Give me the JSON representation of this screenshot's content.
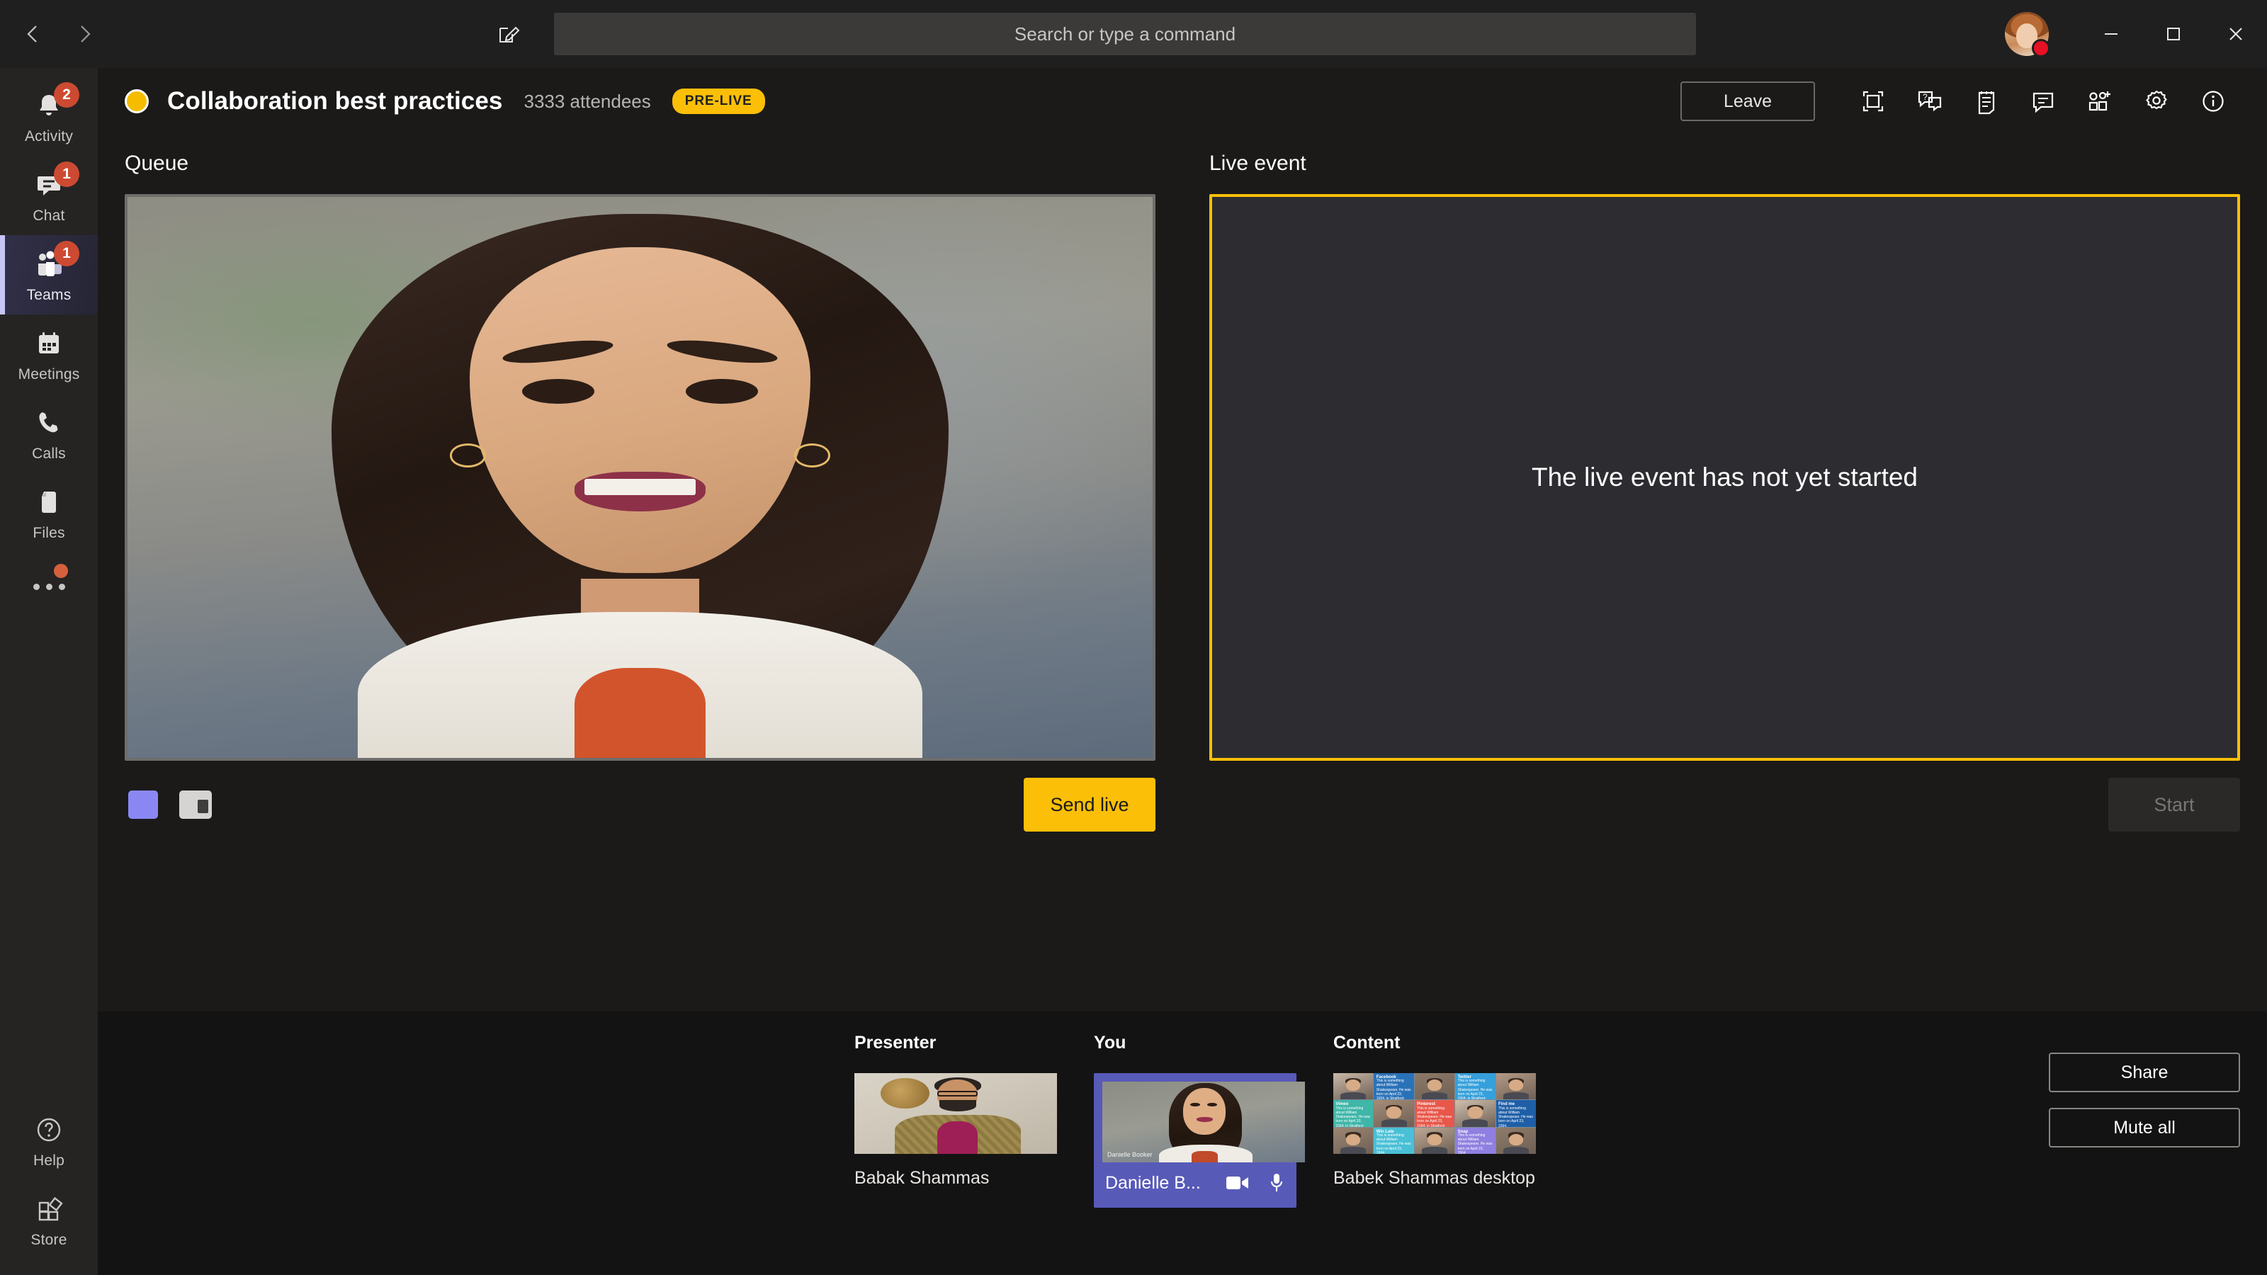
{
  "titlebar": {
    "back_label": "Back",
    "forward_label": "Forward",
    "compose_label": "New chat",
    "search": {
      "placeholder": "Search or type a command",
      "value": ""
    },
    "avatar_name": "Profile",
    "presence": "busy",
    "minimize_label": "Minimize",
    "maximize_label": "Maximize",
    "close_label": "Close"
  },
  "rail": {
    "items": [
      {
        "id": "activity",
        "label": "Activity",
        "badge": "2",
        "active": false
      },
      {
        "id": "chat",
        "label": "Chat",
        "badge": "1",
        "active": false
      },
      {
        "id": "teams",
        "label": "Teams",
        "badge": "1",
        "active": true
      },
      {
        "id": "meetings",
        "label": "Meetings",
        "badge": "",
        "active": false
      },
      {
        "id": "calls",
        "label": "Calls",
        "badge": "",
        "active": false
      },
      {
        "id": "files",
        "label": "Files",
        "badge": "",
        "active": false
      }
    ],
    "more_label": "More apps",
    "bottom": [
      {
        "id": "help",
        "label": "Help"
      },
      {
        "id": "store",
        "label": "Store"
      }
    ]
  },
  "meeting": {
    "title": "Collaboration best practices",
    "attendees": "3333 attendees",
    "status_badge": "PRE-LIVE",
    "leave_label": "Leave",
    "toolbar": [
      {
        "id": "share-screen",
        "label": "Share screen"
      },
      {
        "id": "qna",
        "label": "Q&A"
      },
      {
        "id": "notes",
        "label": "Meeting notes"
      },
      {
        "id": "chat",
        "label": "Show conversation"
      },
      {
        "id": "add-people",
        "label": "Add people"
      },
      {
        "id": "settings",
        "label": "Device settings"
      },
      {
        "id": "info",
        "label": "Meeting info"
      }
    ]
  },
  "queue": {
    "title": "Queue",
    "layout_options": [
      {
        "id": "single",
        "label": "Single frame layout",
        "selected": true
      },
      {
        "id": "split",
        "label": "Side-by-side layout",
        "selected": false
      }
    ],
    "send_live_label": "Send live"
  },
  "live_event": {
    "title": "Live event",
    "message": "The live event has not yet started",
    "start_label": "Start",
    "start_disabled": true
  },
  "tray": {
    "columns": [
      {
        "id": "presenter",
        "heading": "Presenter",
        "name": "Babak Shammas",
        "selected": false
      },
      {
        "id": "you",
        "heading": "You",
        "name": "Danielle B...",
        "selected": true,
        "overlay_name": "Danielle Booker",
        "controls": [
          {
            "id": "video",
            "label": "Video"
          },
          {
            "id": "mic",
            "label": "Microphone"
          }
        ]
      },
      {
        "id": "content",
        "heading": "Content",
        "name": "Babek Shammas desktop",
        "selected": false
      }
    ],
    "content_tiles": [
      {
        "title": "",
        "body": ""
      },
      {
        "title": "Facebook",
        "body": "This is something about William Shakespeare. He was born on April 23, 1564, in Stratford-upon-Avon. The son of John Shakespeare."
      },
      {
        "title": "",
        "body": ""
      },
      {
        "title": "Twitter",
        "body": "This is something about William Shakespeare. He was born on April 23, 1564, in Stratford-upon-Avon."
      },
      {
        "title": "",
        "body": ""
      },
      {
        "title": "Vimeo",
        "body": "This is something about William Shakespeare. He was born on April 23, 1564, in Stratford-upon-Avon."
      },
      {
        "title": "",
        "body": ""
      },
      {
        "title": "Pinterest",
        "body": "This is something about William Shakespeare. He was born on April 23, 1564, in Stratford-upon-Avon."
      },
      {
        "title": "",
        "body": ""
      },
      {
        "title": "Find me",
        "body": "This is something about William Shakespeare. He was born on April 23, 1564."
      },
      {
        "title": "",
        "body": ""
      },
      {
        "title": "Win Late",
        "body": "This is something about William Shakespeare. He was born on April 23, 1564."
      },
      {
        "title": "",
        "body": ""
      },
      {
        "title": "Snap",
        "body": "This is something about William Shakespeare. He was born on April 23, 1564."
      },
      {
        "title": "",
        "body": ""
      }
    ],
    "buttons": [
      {
        "id": "share",
        "label": "Share"
      },
      {
        "id": "mute-all",
        "label": "Mute all"
      }
    ]
  },
  "colors": {
    "accent_yellow": "#fbbf08",
    "accent_purple": "#585ab8",
    "badge_orange": "#cc4a31",
    "presence_busy": "#e81123",
    "window_bg": "#201f1f",
    "main_bg": "#1b1a19",
    "tray_bg": "#141313",
    "live_panel_bg": "#2d2c31"
  }
}
